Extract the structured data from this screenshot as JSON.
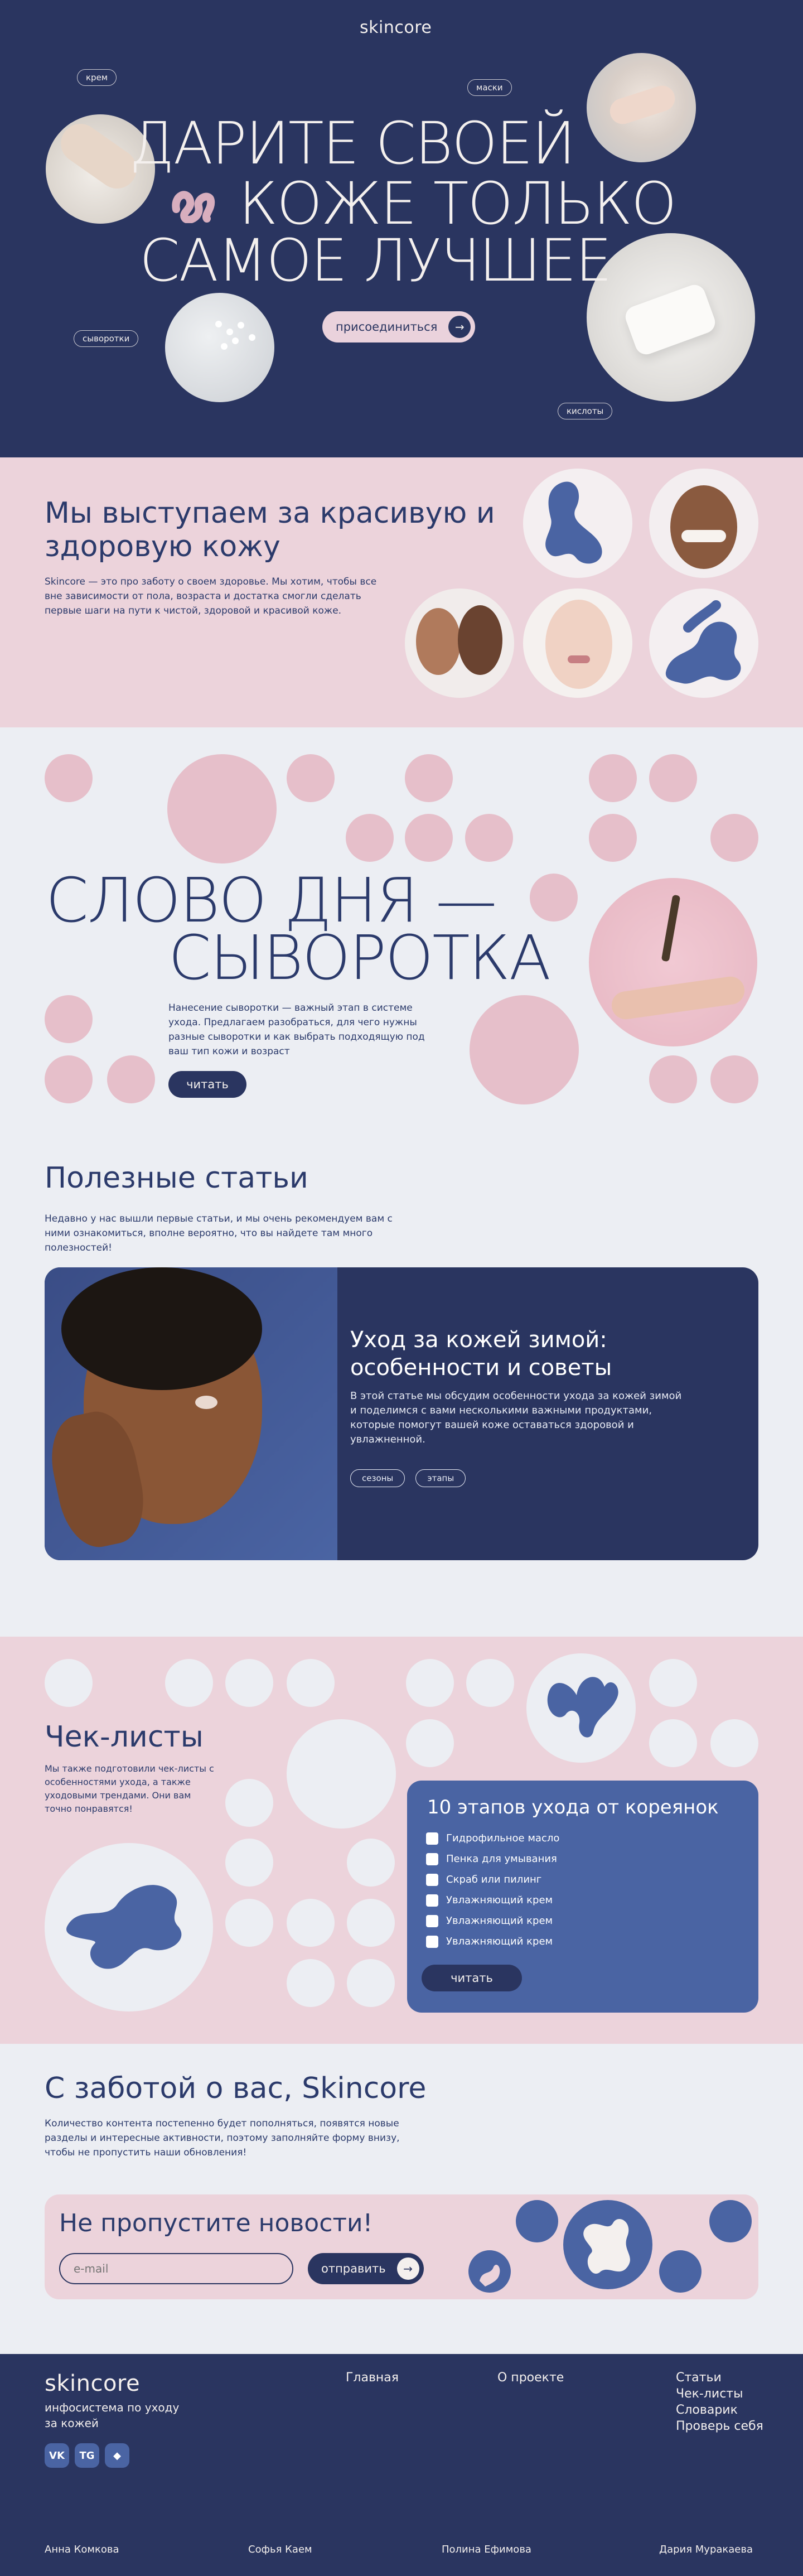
{
  "hero": {
    "logo": "skincore",
    "tags": [
      "крем",
      "маски",
      "сыворотки",
      "кислоты"
    ],
    "title_line1": "ДАРИТЕ СВОЕЙ",
    "title_line2": "КОЖЕ ТОЛЬКО",
    "title_line3": "САМОЕ ЛУЧШЕЕ",
    "join_label": "присоединиться"
  },
  "about": {
    "title": "Мы выступаем за красивую и здоровую кожу",
    "text": "Skincore — это про заботу о своем здоровье. Мы хотим, чтобы все вне зависимости от пола, возраста и достатка смогли сделать первые шаги на пути к чистой, здоровой и красивой коже."
  },
  "word": {
    "title_line1": "СЛОВО ДНЯ —",
    "title_line2": "СЫВОРОТКА",
    "text": "Нанесение сыворотки — важный этап в системе ухода. Предлагаем разобраться, для чего нужны разные сыворотки и как выбрать подходящую под ваш тип кожи и возраст",
    "read_label": "читать"
  },
  "articles": {
    "title": "Полезные статьи",
    "intro": "Недавно у нас вышли первые статьи, и мы очень рекомендуем вам с ними ознакомиться, вполне вероятно, что вы найдете там много полезностей!",
    "card_title": "Уход за кожей зимой: особенности и советы",
    "card_text": "В этой статье мы обсудим особенности ухода за кожей зимой и поделимся с вами несколькими важными продуктами, которые помогут вашей коже оставаться здоровой и увлажненной.",
    "card_tags": [
      "сезоны",
      "этапы"
    ]
  },
  "checklists": {
    "title": "Чек-листы",
    "text": "Мы также подготовили чек-листы с особенностями ухода, а также уходовыми трендами. Они вам точно понравятся!",
    "card_title": "10 этапов ухода от кореянок",
    "items": [
      "Гидрофильное масло",
      "Пенка для умывания",
      "Скраб или пилинг",
      "Увлажняющий крем",
      "Увлажняющий крем",
      "Увлажняющий крем"
    ],
    "read_label": "читать"
  },
  "care": {
    "title": "С заботой о вас, Skincore",
    "text": "Количество контента постепенно будет пополняться, появятся новые разделы и интересные активности, поэтому заполняйте форму внизу, чтобы не пропустить наши обновления!"
  },
  "subscribe": {
    "title": "Не пропустите новости!",
    "email_placeholder": "e-mail",
    "send_label": "отправить"
  },
  "footer": {
    "logo": "skincore",
    "tagline": "инфосистема по уходу за кожей",
    "social": [
      "VK",
      "TG",
      "◆"
    ],
    "nav_main": "Главная",
    "nav_about": "О проекте",
    "links": [
      "Статьи",
      "Чек-листы",
      "Словарик",
      "Проверь себя"
    ],
    "authors": [
      "Анна Комкова",
      "Софья Каем",
      "Полина Ефимова",
      "Дария Муракаева"
    ]
  },
  "colors": {
    "navy": "#2a3560",
    "pink": "#ecd3db",
    "blue": "#4a64a3",
    "light": "#eceef3"
  }
}
